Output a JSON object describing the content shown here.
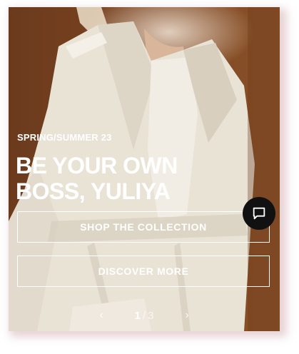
{
  "hero": {
    "eyebrow": "SPRING/SUMMER 23",
    "headline_line1": "BE YOUR OWN",
    "headline_line2": "BOSS, YULIYA",
    "buttons": {
      "shop": "SHOP THE COLLECTION",
      "discover": "DISCOVER MORE"
    }
  },
  "pagination": {
    "current": "1",
    "separator": "/",
    "total": "3",
    "prev_icon": "chevron-left-icon",
    "next_icon": "chevron-right-icon"
  },
  "chat": {
    "icon": "chat-bubble-icon"
  },
  "colors": {
    "background": "#7a4320",
    "text": "#ffffff",
    "chat_button": "#111111"
  }
}
